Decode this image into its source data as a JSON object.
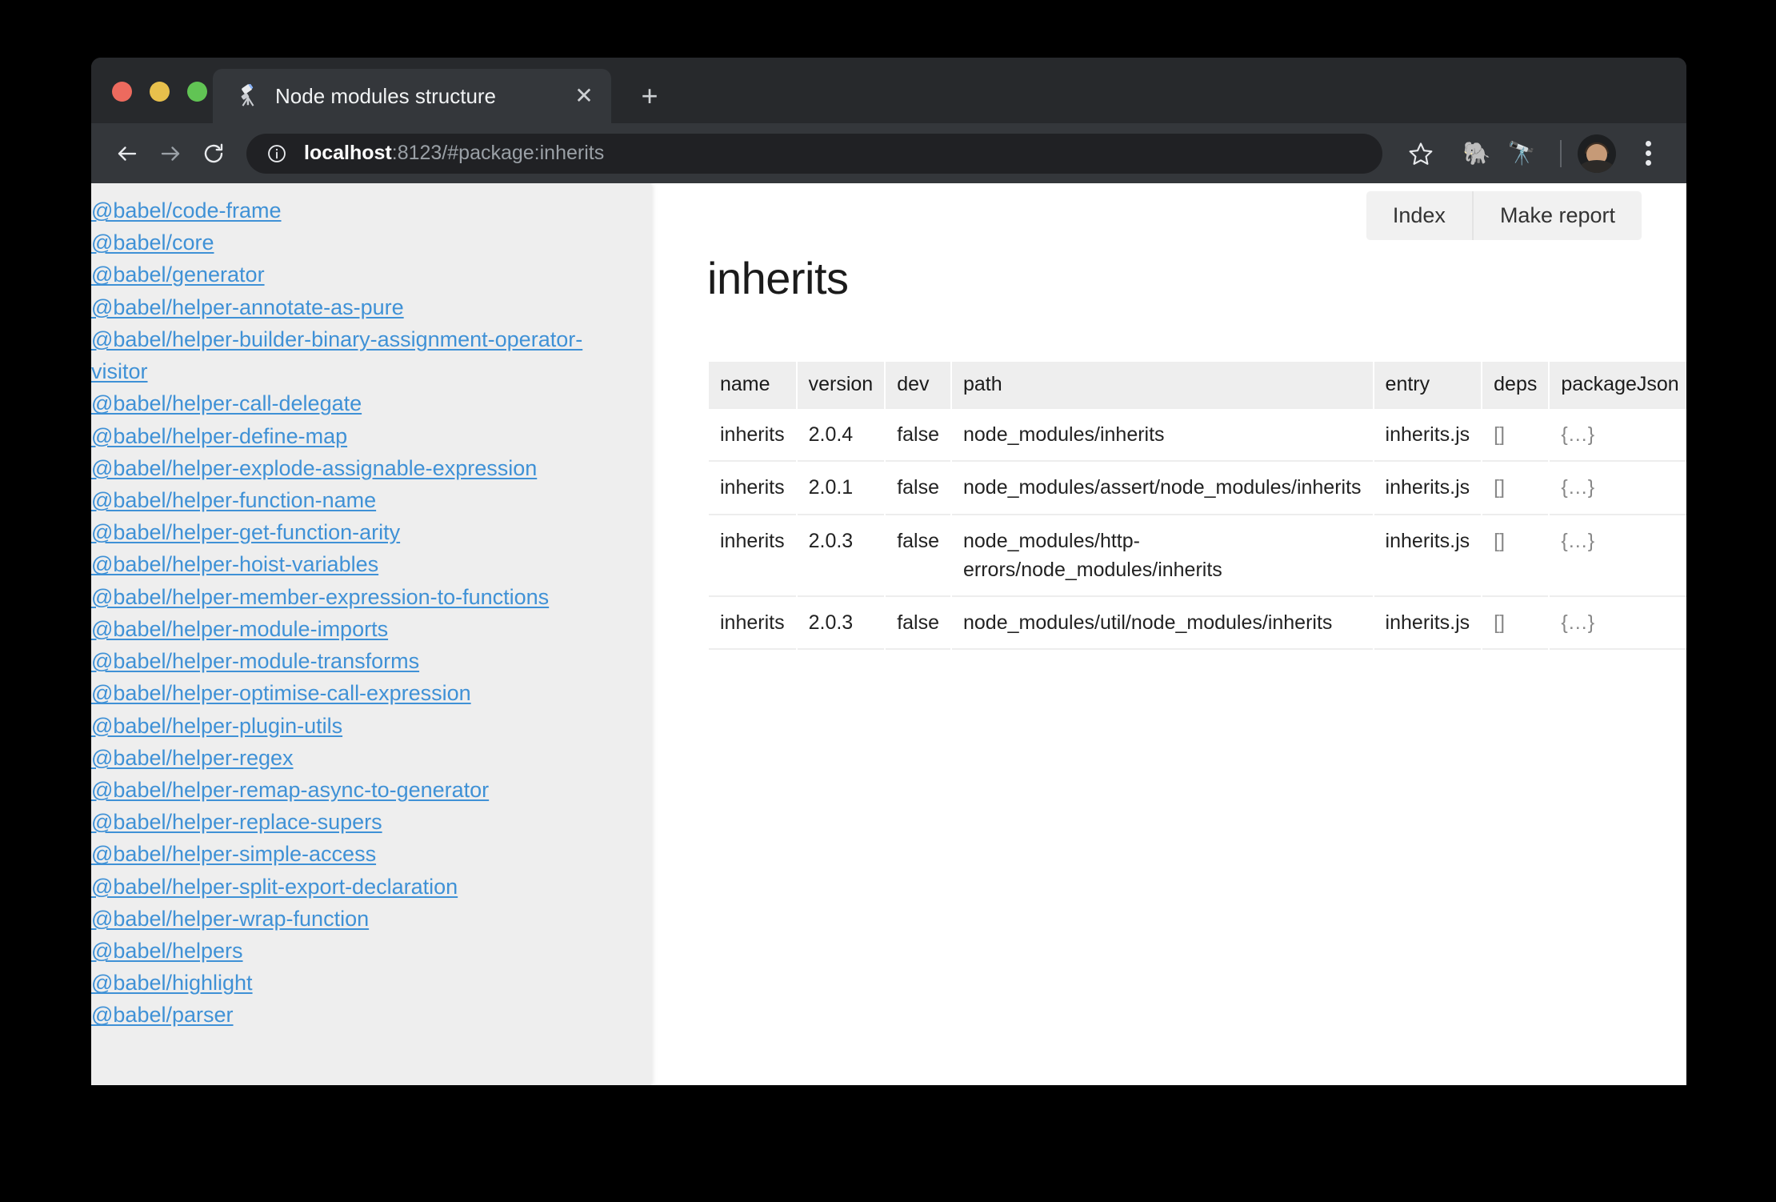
{
  "window": {
    "traffic_lights": [
      {
        "name": "close",
        "color": "#ED6A5E"
      },
      {
        "name": "minimize",
        "color": "#E8C04C"
      },
      {
        "name": "zoom",
        "color": "#61C454"
      }
    ]
  },
  "tab": {
    "title": "Node modules structure",
    "favicon": "telescope-icon",
    "close_label": "✕",
    "new_tab_label": "+"
  },
  "toolbar": {
    "back_label": "back-icon",
    "forward_label": "forward-icon",
    "reload_label": "reload-icon",
    "site_info_label": "info-icon",
    "url_host": "localhost",
    "url_rest": ":8123/#package:inherits",
    "bookmark_label": "star-icon",
    "extension_1": "🐘",
    "extension_2": "🔭",
    "profile_label": "avatar",
    "menu_label": "three-dot-menu-icon"
  },
  "sidebar": {
    "packages": [
      "@babel/code-frame",
      "@babel/core",
      "@babel/generator",
      "@babel/helper-annotate-as-pure",
      "@babel/helper-builder-binary-assignment-operator-visitor",
      "@babel/helper-call-delegate",
      "@babel/helper-define-map",
      "@babel/helper-explode-assignable-expression",
      "@babel/helper-function-name",
      "@babel/helper-get-function-arity",
      "@babel/helper-hoist-variables",
      "@babel/helper-member-expression-to-functions",
      "@babel/helper-module-imports",
      "@babel/helper-module-transforms",
      "@babel/helper-optimise-call-expression",
      "@babel/helper-plugin-utils",
      "@babel/helper-regex",
      "@babel/helper-remap-async-to-generator",
      "@babel/helper-replace-supers",
      "@babel/helper-simple-access",
      "@babel/helper-split-export-declaration",
      "@babel/helper-wrap-function",
      "@babel/helpers",
      "@babel/highlight",
      "@babel/parser"
    ]
  },
  "main": {
    "view_switch": [
      {
        "label": "Index"
      },
      {
        "label": "Make report"
      }
    ],
    "title": "inherits",
    "table": {
      "columns": [
        "name",
        "version",
        "dev",
        "path",
        "entry",
        "deps",
        "packageJson"
      ],
      "rows": [
        {
          "name": "inherits",
          "version": "2.0.4",
          "dev": "false",
          "path": "node_modules/inherits",
          "entry": "inherits.js",
          "deps": "[]",
          "packageJson": "{…}"
        },
        {
          "name": "inherits",
          "version": "2.0.1",
          "dev": "false",
          "path": "node_modules/assert/node_modules/inherits",
          "entry": "inherits.js",
          "deps": "[]",
          "packageJson": "{…}"
        },
        {
          "name": "inherits",
          "version": "2.0.3",
          "dev": "false",
          "path": "node_modules/http-errors/node_modules/inherits",
          "entry": "inherits.js",
          "deps": "[]",
          "packageJson": "{…}"
        },
        {
          "name": "inherits",
          "version": "2.0.3",
          "dev": "false",
          "path": "node_modules/util/node_modules/inherits",
          "entry": "inherits.js",
          "deps": "[]",
          "packageJson": "{…}"
        }
      ]
    }
  }
}
